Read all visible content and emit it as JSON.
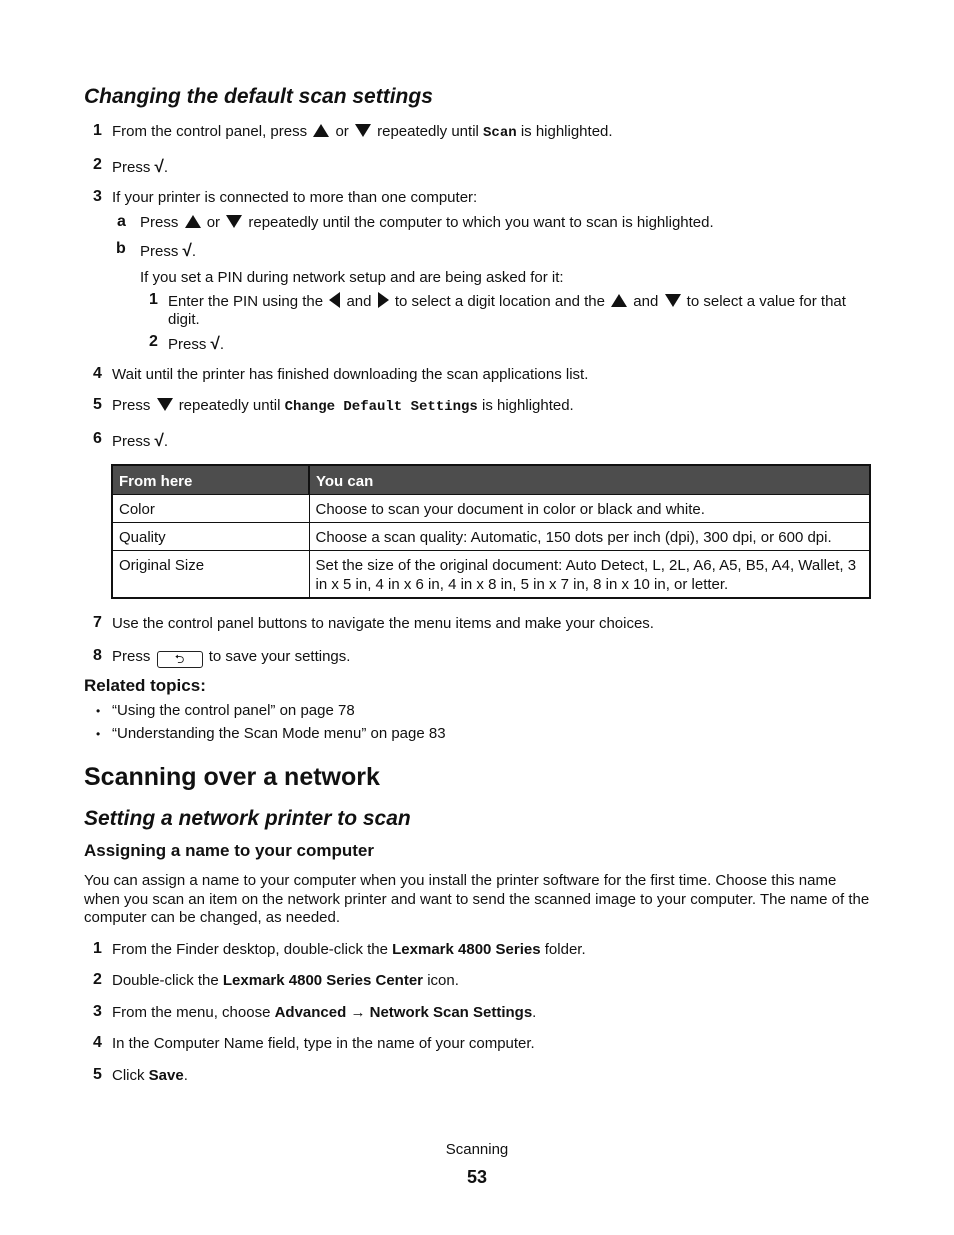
{
  "section1": {
    "title": "Changing the default scan settings",
    "steps": [
      {
        "n": "1",
        "pre": "From the control panel, press",
        "or": "or",
        "mid": "repeatedly until",
        "code": "Scan",
        "post": "is highlighted."
      },
      {
        "n": "2",
        "pre": "Press",
        "post": "."
      },
      {
        "n": "3",
        "text": "If your printer is connected to more than one computer:"
      },
      {
        "n": "4",
        "text": "Wait until the printer has finished downloading the scan applications list."
      },
      {
        "n": "5",
        "pre": "Press",
        "mid": "repeatedly until",
        "code": "Change Default Settings",
        "post": "is highlighted."
      },
      {
        "n": "6",
        "pre": "Press",
        "post": "."
      },
      {
        "n": "7",
        "text": "Use the control panel buttons to navigate the menu items and make your choices."
      },
      {
        "n": "8",
        "pre": "Press",
        "post": "to save your settings."
      }
    ],
    "substeps": [
      {
        "n": "a",
        "pre": "Press",
        "or": "or",
        "post": "repeatedly until the computer to which you want to scan is highlighted."
      },
      {
        "n": "b",
        "pre": "Press",
        "post": "."
      }
    ],
    "pin_intro": "If you set a PIN during network setup and are being asked for it:",
    "pin_steps": [
      {
        "n": "1",
        "pre": "Enter the PIN using the",
        "and1": "and",
        "mid": "to select a digit location and the",
        "and2": "and",
        "post": "to select a value for that",
        "wrap": "digit."
      },
      {
        "n": "2",
        "pre": "Press",
        "post": "."
      }
    ],
    "table": {
      "headers": [
        "From here",
        "You can"
      ],
      "rows": [
        [
          "Color",
          "Choose to scan your document in color or black and white."
        ],
        [
          "Quality",
          "Choose a scan quality: Automatic, 150 dots per inch (dpi), 300 dpi, or 600 dpi."
        ],
        [
          "Original Size",
          "Set the size of the original document: Auto Detect, L, 2L, A6, A5, B5, A4, Wallet, 3 in x 5 in, 4 in x 6 in, 4 in x 8 in, 5 in x 7 in, 8 in x 10 in, or letter."
        ]
      ]
    },
    "related_title": "Related topics:",
    "related": [
      "“Using the control panel” on page 78",
      "“Understanding the Scan Mode menu” on page 83"
    ]
  },
  "section2": {
    "title": "Scanning over a network",
    "subtitle": "Setting a network printer to scan",
    "subsubtitle": "Assigning a name to your computer",
    "intro": "You can assign a name to your computer when you install the printer software for the first time. Choose this name when you scan an item on the network printer and want to send the scanned image to your computer. The name of the computer can be changed, as needed.",
    "steps": [
      {
        "n": "1",
        "pre": "From the Finder desktop, double-click the ",
        "bold": "Lexmark 4800 Series",
        "post": " folder."
      },
      {
        "n": "2",
        "pre": "Double-click the ",
        "bold": "Lexmark 4800 Series Center",
        "post": " icon."
      },
      {
        "n": "3",
        "pre": "From the menu, choose ",
        "bold": "Advanced",
        "arrow": " → ",
        "bold2": "Network Scan Settings",
        "post": "."
      },
      {
        "n": "4",
        "text": "In the Computer Name field, type in the name of your computer."
      },
      {
        "n": "5",
        "pre": "Click ",
        "bold": "Save",
        "post": "."
      }
    ]
  },
  "icons": {
    "check": "√",
    "back": "⮌"
  },
  "footer": {
    "chapter": "Scanning",
    "page": "53"
  }
}
